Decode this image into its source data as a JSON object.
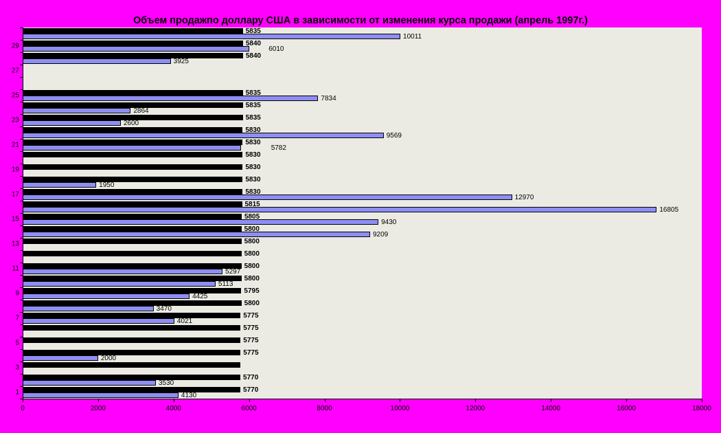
{
  "title": "Объем продажпо доллару США в зависимости от изменения курса продажи (апрель 1997г.)",
  "colors": {
    "background": "#FF00FF",
    "plot_wall": "#EBEBE4",
    "volume_bar_fill": "#8E8EF2",
    "rate_bar_fill": "#000000",
    "bar_border": "#000000",
    "text": "#000000"
  },
  "x_axis": {
    "min": 0,
    "max": 18000,
    "step": 2000,
    "tick_labels": [
      "0",
      "2000",
      "4000",
      "6000",
      "8000",
      "10000",
      "12000",
      "14000",
      "16000",
      "18000"
    ]
  },
  "y_axis": {
    "tick_labels": [
      "1",
      "3",
      "5",
      "7",
      "9",
      "11",
      "13",
      "15",
      "17",
      "19",
      "21",
      "23",
      "25",
      "27",
      "29"
    ]
  },
  "chart_data": {
    "type": "bar",
    "orientation": "horizontal",
    "title": "Объем продажпо доллару США в зависимости от изменения курса продажи (апрель 1997г.)",
    "xlabel": "",
    "ylabel": "",
    "xlim": [
      0,
      18000
    ],
    "grid": false,
    "legend": false,
    "categories_note": "days of April 1997, day 1 at bottom, day 30 at top; odd days labeled on axis",
    "series_note": "each day has a black bar (exchange rate, value label shown) and a blue bar (sales volume, value label shown); null = no bar drawn",
    "days": [
      {
        "day": 1,
        "rate": 5770,
        "rate_label": "5770",
        "volume": 4130,
        "volume_label": "4130",
        "volume_label_dx": 0
      },
      {
        "day": 2,
        "rate": 5770,
        "rate_label": "5770",
        "volume": 3530,
        "volume_label": "3530",
        "volume_label_dx": 0
      },
      {
        "day": 3,
        "rate": 5770,
        "rate_label": "",
        "volume": null,
        "volume_label": "",
        "volume_label_dx": 0
      },
      {
        "day": 4,
        "rate": 5775,
        "rate_label": "5775",
        "volume": 2000,
        "volume_label": "2000",
        "volume_label_dx": 0
      },
      {
        "day": 5,
        "rate": 5775,
        "rate_label": "5775",
        "volume": null,
        "volume_label": "",
        "volume_label_dx": 0
      },
      {
        "day": 6,
        "rate": 5775,
        "rate_label": "5775",
        "volume": null,
        "volume_label": "",
        "volume_label_dx": 0
      },
      {
        "day": 7,
        "rate": 5775,
        "rate_label": "5775",
        "volume": 4021,
        "volume_label": "4021",
        "volume_label_dx": 0
      },
      {
        "day": 8,
        "rate": 5800,
        "rate_label": "5800",
        "volume": 3470,
        "volume_label": "3470",
        "volume_label_dx": 0
      },
      {
        "day": 9,
        "rate": 5795,
        "rate_label": "5795",
        "volume": 4425,
        "volume_label": "4425",
        "volume_label_dx": 0
      },
      {
        "day": 10,
        "rate": 5800,
        "rate_label": "5800",
        "volume": 5113,
        "volume_label": "5113",
        "volume_label_dx": 0
      },
      {
        "day": 11,
        "rate": 5800,
        "rate_label": "5800",
        "volume": 5297,
        "volume_label": "5297",
        "volume_label_dx": 0
      },
      {
        "day": 12,
        "rate": 5800,
        "rate_label": "5800",
        "volume": null,
        "volume_label": "",
        "volume_label_dx": 0
      },
      {
        "day": 13,
        "rate": 5800,
        "rate_label": "5800",
        "volume": null,
        "volume_label": "",
        "volume_label_dx": 0
      },
      {
        "day": 14,
        "rate": 5800,
        "rate_label": "5800",
        "volume": 9209,
        "volume_label": "9209",
        "volume_label_dx": 0
      },
      {
        "day": 15,
        "rate": 5805,
        "rate_label": "5805",
        "volume": 9430,
        "volume_label": "9430",
        "volume_label_dx": 0
      },
      {
        "day": 16,
        "rate": 5815,
        "rate_label": "5815",
        "volume": 16805,
        "volume_label": "16805",
        "volume_label_dx": 0
      },
      {
        "day": 17,
        "rate": 5830,
        "rate_label": "5830",
        "volume": 12970,
        "volume_label": "12970",
        "volume_label_dx": 0
      },
      {
        "day": 18,
        "rate": 5830,
        "rate_label": "5830",
        "volume": 1950,
        "volume_label": "1950",
        "volume_label_dx": 0
      },
      {
        "day": 19,
        "rate": 5830,
        "rate_label": "5830",
        "volume": null,
        "volume_label": "",
        "volume_label_dx": 0
      },
      {
        "day": 20,
        "rate": 5830,
        "rate_label": "5830",
        "volume": null,
        "volume_label": "",
        "volume_label_dx": 0
      },
      {
        "day": 21,
        "rate": 5830,
        "rate_label": "5830",
        "volume": 5782,
        "volume_label": "5782",
        "volume_label_dx": 40
      },
      {
        "day": 22,
        "rate": 5830,
        "rate_label": "5830",
        "volume": 9569,
        "volume_label": "9569",
        "volume_label_dx": 0
      },
      {
        "day": 23,
        "rate": 5835,
        "rate_label": "5835",
        "volume": 2600,
        "volume_label": "2600",
        "volume_label_dx": 0
      },
      {
        "day": 24,
        "rate": 5835,
        "rate_label": "5835",
        "volume": 2864,
        "volume_label": "2864",
        "volume_label_dx": 0
      },
      {
        "day": 25,
        "rate": 5835,
        "rate_label": "5835",
        "volume": 7834,
        "volume_label": "7834",
        "volume_label_dx": 0
      },
      {
        "day": 26,
        "rate": null,
        "rate_label": "",
        "volume": null,
        "volume_label": "",
        "volume_label_dx": 0
      },
      {
        "day": 27,
        "rate": null,
        "rate_label": "",
        "volume": null,
        "volume_label": "",
        "volume_label_dx": 0
      },
      {
        "day": 28,
        "rate": 5840,
        "rate_label": "5840",
        "volume": 3925,
        "volume_label": "3925",
        "volume_label_dx": 0
      },
      {
        "day": 29,
        "rate": 5840,
        "rate_label": "5840",
        "volume": 6010,
        "volume_label": "6010",
        "volume_label_dx": 24
      },
      {
        "day": 30,
        "rate": 5835,
        "rate_label": "5835",
        "volume": 10011,
        "volume_label": "10011",
        "volume_label_dx": 0
      }
    ]
  }
}
